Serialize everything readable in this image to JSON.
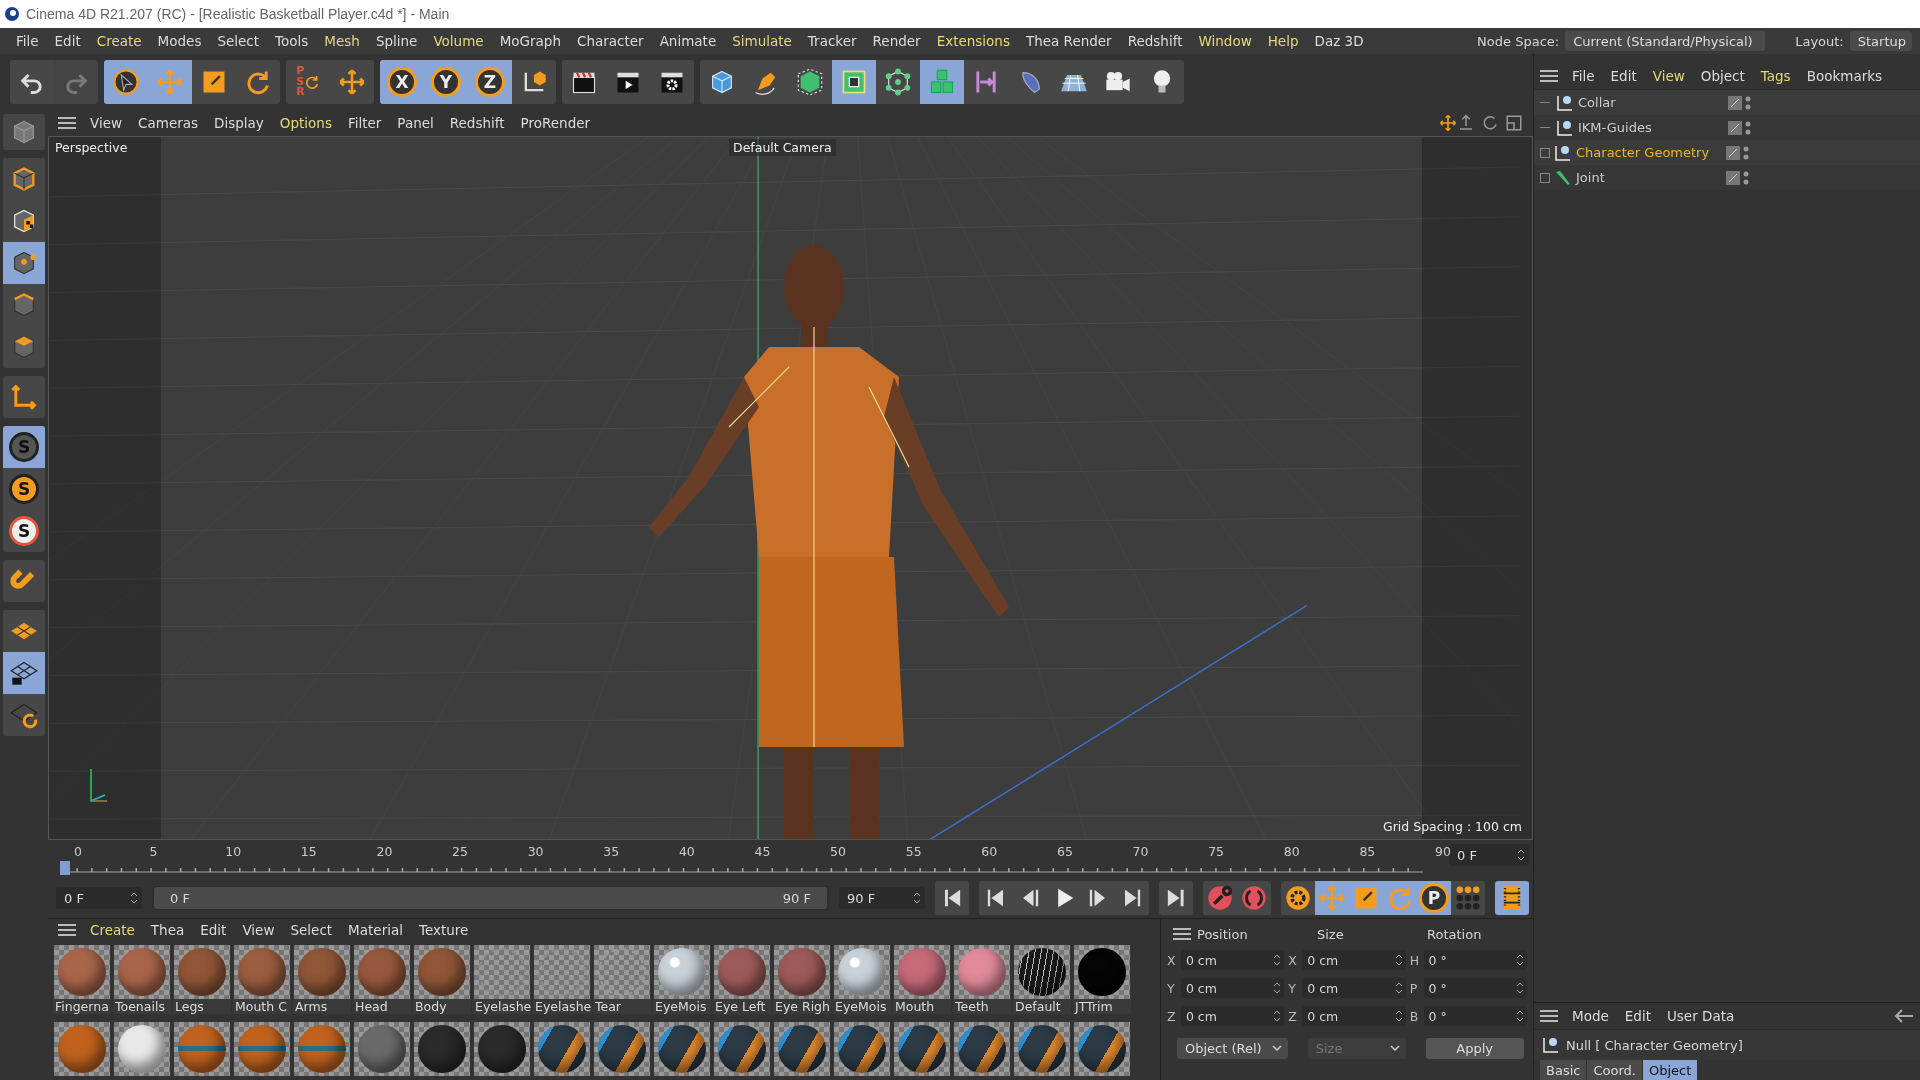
{
  "window": {
    "title": "Cinema 4D R21.207 (RC) - [Realistic Basketball Player.c4d *] - Main"
  },
  "menu": [
    {
      "label": "File",
      "accent": false
    },
    {
      "label": "Edit",
      "accent": false
    },
    {
      "label": "Create",
      "accent": true
    },
    {
      "label": "Modes",
      "accent": false
    },
    {
      "label": "Select",
      "accent": false
    },
    {
      "label": "Tools",
      "accent": false
    },
    {
      "label": "Mesh",
      "accent": true
    },
    {
      "label": "Spline",
      "accent": false
    },
    {
      "label": "Volume",
      "accent": true
    },
    {
      "label": "MoGraph",
      "accent": false
    },
    {
      "label": "Character",
      "accent": false
    },
    {
      "label": "Animate",
      "accent": false
    },
    {
      "label": "Simulate",
      "accent": true
    },
    {
      "label": "Tracker",
      "accent": false
    },
    {
      "label": "Render",
      "accent": false
    },
    {
      "label": "Extensions",
      "accent": true
    },
    {
      "label": "Thea Render",
      "accent": false
    },
    {
      "label": "Redshift",
      "accent": false
    },
    {
      "label": "Window",
      "accent": true
    },
    {
      "label": "Help",
      "accent": true
    },
    {
      "label": "Daz 3D",
      "accent": false
    }
  ],
  "node_space": {
    "label": "Node Space:",
    "value": "Current (Standard/Physical)"
  },
  "layout": {
    "label": "Layout:",
    "value": "Startup"
  },
  "toolbar": [
    {
      "buttons": [
        {
          "kind": "undo",
          "selected": false,
          "disabled": false
        },
        {
          "kind": "redo",
          "selected": false,
          "disabled": true
        }
      ]
    },
    {
      "buttons": [
        {
          "kind": "pointer",
          "selected": true,
          "disabled": false
        },
        {
          "kind": "move",
          "selected": true,
          "disabled": false
        },
        {
          "kind": "scale",
          "selected": false,
          "disabled": false
        },
        {
          "kind": "rotate",
          "selected": false,
          "disabled": false
        }
      ]
    },
    {
      "buttons": [
        {
          "kind": "psr",
          "label": "PSR",
          "selected": false,
          "disabled": false
        },
        {
          "kind": "move",
          "selected": false,
          "disabled": false
        }
      ]
    },
    {
      "buttons": [
        {
          "kind": "letter",
          "label": "X",
          "selected": true,
          "disabled": false
        },
        {
          "kind": "letter",
          "label": "Y",
          "selected": true,
          "disabled": false
        },
        {
          "kind": "letter",
          "label": "Z",
          "selected": true,
          "disabled": false
        },
        {
          "kind": "coord",
          "selected": false,
          "disabled": false
        }
      ]
    },
    {
      "buttons": [
        {
          "kind": "clapper",
          "selected": false,
          "disabled": false
        },
        {
          "kind": "render",
          "selected": false,
          "disabled": false
        },
        {
          "kind": "render-settings",
          "selected": false,
          "disabled": false
        }
      ]
    },
    {
      "buttons": [
        {
          "kind": "cube",
          "selected": false,
          "disabled": false
        },
        {
          "kind": "pen",
          "selected": false,
          "disabled": false
        },
        {
          "kind": "subdiv",
          "selected": false,
          "disabled": false
        },
        {
          "kind": "frame-cube",
          "selected": true,
          "disabled": false
        },
        {
          "kind": "mograph",
          "selected": false,
          "disabled": false
        },
        {
          "kind": "cubes",
          "selected": true,
          "disabled": false
        },
        {
          "kind": "deformer",
          "selected": false,
          "disabled": false
        },
        {
          "kind": "surface",
          "selected": false,
          "disabled": false
        },
        {
          "kind": "floor",
          "selected": false,
          "disabled": false
        },
        {
          "kind": "camera",
          "selected": false,
          "disabled": false
        },
        {
          "kind": "light",
          "selected": false,
          "disabled": false
        }
      ]
    }
  ],
  "left_toolbar": [
    {
      "buttons": [
        {
          "kind": "cube-gray",
          "selected": false
        }
      ]
    },
    {
      "buttons": [
        {
          "kind": "model",
          "selected": false
        },
        {
          "kind": "texture",
          "selected": false
        },
        {
          "kind": "points",
          "selected": true
        },
        {
          "kind": "edges",
          "selected": false
        },
        {
          "kind": "polygons",
          "selected": false
        }
      ]
    },
    {
      "buttons": [
        {
          "kind": "axis",
          "selected": false
        }
      ]
    },
    {
      "buttons": [
        {
          "kind": "snap",
          "label": "S",
          "selected": true
        },
        {
          "kind": "snap-orange",
          "label": "S",
          "selected": false
        },
        {
          "kind": "snap-ring",
          "label": "S",
          "selected": false
        }
      ]
    },
    {
      "buttons": [
        {
          "kind": "magnet",
          "selected": false
        }
      ]
    },
    {
      "buttons": [
        {
          "kind": "workplane",
          "selected": false
        },
        {
          "kind": "workplane-lock",
          "selected": true
        },
        {
          "kind": "workplane-rotate",
          "selected": false
        }
      ]
    }
  ],
  "viewport": {
    "menu": [
      {
        "label": "View",
        "accent": false
      },
      {
        "label": "Cameras",
        "accent": false
      },
      {
        "label": "Display",
        "accent": false
      },
      {
        "label": "Options",
        "accent": true
      },
      {
        "label": "Filter",
        "accent": false
      },
      {
        "label": "Panel",
        "accent": false
      },
      {
        "label": "Redshift",
        "accent": false
      },
      {
        "label": "ProRender",
        "accent": false
      }
    ],
    "label": "Perspective",
    "camera": "Default Camera",
    "grid_spacing": "Grid Spacing : 100 cm"
  },
  "timeline": {
    "ticks": [
      "0",
      "5",
      "10",
      "15",
      "20",
      "25",
      "30",
      "35",
      "40",
      "45",
      "50",
      "55",
      "60",
      "65",
      "70",
      "75",
      "80",
      "85",
      "90"
    ],
    "level": 0,
    "current_frame": "0 F",
    "start": "0 F",
    "range": {
      "start": "0 F",
      "end": "90 F",
      "level": 1
    },
    "end": "90 F"
  },
  "transport": [
    {
      "buttons": [
        {
          "kind": "start",
          "selected": false
        }
      ]
    },
    {
      "buttons": [
        {
          "kind": "prev-key",
          "selected": false
        },
        {
          "kind": "prev",
          "selected": false
        },
        {
          "kind": "play",
          "selected": false
        },
        {
          "kind": "next",
          "selected": false
        },
        {
          "kind": "next-key",
          "selected": false
        }
      ]
    },
    {
      "buttons": [
        {
          "kind": "end",
          "selected": false
        }
      ]
    },
    {
      "buttons": [
        {
          "kind": "record",
          "selected": false
        },
        {
          "kind": "auto-key",
          "selected": false
        }
      ]
    },
    {
      "buttons": [
        {
          "kind": "key-settings",
          "selected": false
        },
        {
          "kind": "move",
          "selected": true
        },
        {
          "kind": "scale",
          "selected": true
        },
        {
          "kind": "rotate",
          "selected": true
        },
        {
          "kind": "letter",
          "label": "P",
          "selected": true
        },
        {
          "kind": "dots",
          "selected": false
        }
      ]
    },
    {
      "buttons": [
        {
          "kind": "film",
          "selected": true
        }
      ]
    }
  ],
  "materials": {
    "menu": [
      {
        "label": "Create",
        "accent": true
      },
      {
        "label": "Thea",
        "accent": false
      },
      {
        "label": "Edit",
        "accent": false
      },
      {
        "label": "View",
        "accent": false
      },
      {
        "label": "Select",
        "accent": false
      },
      {
        "label": "Material",
        "accent": false
      },
      {
        "label": "Texture",
        "accent": false
      }
    ],
    "items": [
      {
        "name": "Fingerna",
        "kind": "solid",
        "color": "#a8654a"
      },
      {
        "name": "Toenails",
        "kind": "solid",
        "color": "#a8654a"
      },
      {
        "name": "Legs",
        "kind": "solid",
        "color": "#8f5637"
      },
      {
        "name": "Mouth C",
        "kind": "solid",
        "color": "#9a5d40"
      },
      {
        "name": "Arms",
        "kind": "solid",
        "color": "#8f5637"
      },
      {
        "name": "Head",
        "kind": "solid",
        "color": "#95583c"
      },
      {
        "name": "Body",
        "kind": "solid",
        "color": "#8f5637"
      },
      {
        "name": "Eyelashe",
        "kind": "none",
        "color": "#8a8a8a"
      },
      {
        "name": "Eyelashe",
        "kind": "none",
        "color": "#8a8a8a"
      },
      {
        "name": "Tear",
        "kind": "none",
        "color": "#9a9a9a"
      },
      {
        "name": "EyeMois",
        "kind": "glass",
        "color": "#c8d0d8"
      },
      {
        "name": "Eye Left",
        "kind": "solid",
        "color": "#9c5a58"
      },
      {
        "name": "Eye Righ",
        "kind": "solid",
        "color": "#9c5a58"
      },
      {
        "name": "EyeMois",
        "kind": "glass",
        "color": "#c8d0d8"
      },
      {
        "name": "Mouth",
        "kind": "solid",
        "color": "#c66a78"
      },
      {
        "name": "Teeth",
        "kind": "solid",
        "color": "#e08a9a"
      },
      {
        "name": "Default",
        "kind": "striped",
        "color": "#1a1a1a"
      },
      {
        "name": "JTTrim",
        "kind": "solid",
        "color": "#050505"
      }
    ],
    "row2": [
      {
        "kind": "solid",
        "color": "#c0621e"
      },
      {
        "kind": "solid",
        "color": "#e8e8e8"
      },
      {
        "kind": "banded",
        "color": "#c0621e"
      },
      {
        "kind": "banded",
        "color": "#c0621e"
      },
      {
        "kind": "banded",
        "color": "#c0621e"
      },
      {
        "kind": "solid",
        "color": "#6a6a6a"
      },
      {
        "kind": "solid",
        "color": "#2a2a2a"
      },
      {
        "kind": "solid",
        "color": "#2a2a2a"
      },
      {
        "kind": "split",
        "color": "#2b3a44"
      },
      {
        "kind": "split",
        "color": "#2b3a44"
      },
      {
        "kind": "split",
        "color": "#2b3a44"
      },
      {
        "kind": "split",
        "color": "#2b3a44"
      },
      {
        "kind": "split",
        "color": "#2b3a44"
      },
      {
        "kind": "split",
        "color": "#2b3a44"
      },
      {
        "kind": "split",
        "color": "#2b3a44"
      },
      {
        "kind": "split",
        "color": "#2b3a44"
      },
      {
        "kind": "split",
        "color": "#2b3a44"
      },
      {
        "kind": "split",
        "color": "#2b3a44"
      }
    ]
  },
  "coordinates": {
    "headers": [
      "Position",
      "Size",
      "Rotation"
    ],
    "rows": [
      {
        "pos_label": "X",
        "pos": "0 cm",
        "size_label": "X",
        "size": "0 cm",
        "rot_label": "H",
        "rot": "0 °"
      },
      {
        "pos_label": "Y",
        "pos": "0 cm",
        "size_label": "Y",
        "size": "0 cm",
        "rot_label": "P",
        "rot": "0 °"
      },
      {
        "pos_label": "Z",
        "pos": "0 cm",
        "size_label": "Z",
        "size": "0 cm",
        "rot_label": "B",
        "rot": "0 °"
      }
    ],
    "mode": "Object (Rel)",
    "size_mode": "Size",
    "apply": "Apply"
  },
  "objects": {
    "menu": [
      {
        "label": "File",
        "accent": false
      },
      {
        "label": "Edit",
        "accent": false
      },
      {
        "label": "View",
        "accent": true
      },
      {
        "label": "Object",
        "accent": false
      },
      {
        "label": "Tags",
        "accent": true
      },
      {
        "label": "Bookmarks",
        "accent": false
      }
    ],
    "rows": [
      {
        "name": "Collar",
        "kind": "null",
        "selected": false,
        "has_children": false
      },
      {
        "name": "IKM-Guides",
        "kind": "null",
        "selected": false,
        "has_children": false
      },
      {
        "name": "Character Geometry",
        "kind": "null",
        "selected": true,
        "has_children": true
      },
      {
        "name": "Joint",
        "kind": "joint",
        "selected": false,
        "has_children": true
      }
    ]
  },
  "attributes": {
    "menu": [
      "Mode",
      "Edit",
      "User Data"
    ],
    "title": "Null [ Character Geometry]",
    "tabs": [
      {
        "label": "Basic",
        "selected": false
      },
      {
        "label": "Coord.",
        "selected": false
      },
      {
        "label": "Object",
        "selected": true
      }
    ]
  }
}
